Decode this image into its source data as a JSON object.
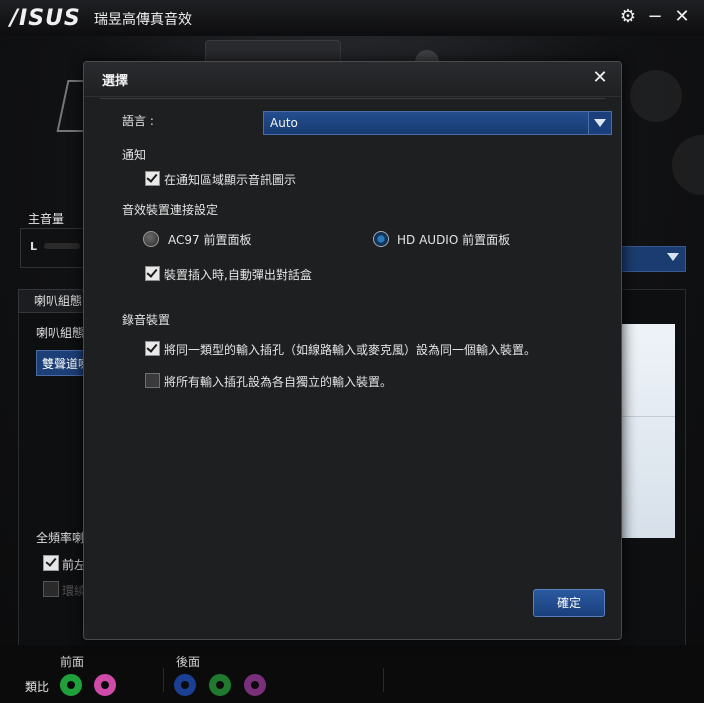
{
  "app": {
    "brand": "/ISUS",
    "title": "瑞昱高傳真音效",
    "gear_icon": "gear-icon",
    "minimize_icon": "minimize-icon",
    "close_icon": "close-icon"
  },
  "background": {
    "master_volume_label": "主音量",
    "volume_channel_left": "L",
    "speaker_tab": "喇叭組態",
    "speaker_config_label": "喇叭組態",
    "stereo_button": "雙聲道喇",
    "fullrange_label": "全頻率喇",
    "front_lr_label": "前左",
    "surround_label": "環繞",
    "front_panel_label": "前面",
    "rear_panel_label": "後面",
    "analog_label": "類比",
    "jack_colors": {
      "front_green": "#1fa03a",
      "front_pink": "#d04aa8",
      "rear_blue": "#1b3f92",
      "rear_green": "#1f7a30",
      "rear_purple": "#7a2f7a"
    }
  },
  "dialog": {
    "title": "選擇",
    "close_icon": "close-icon",
    "language_label": "語言 :",
    "language_value": "Auto",
    "notify_section": "通知",
    "notify_tray_icon": "在通知區域顯示音訊圖示",
    "connection_section": "音效裝置連接設定",
    "ac97_option": "AC97 前置面板",
    "hd_audio_option": "HD AUDIO 前置面板",
    "auto_popup": "裝置插入時,自動彈出對話盒",
    "recording_section": "錄音裝置",
    "same_type_input": "將同一類型的輸入插孔（如線路輸入或麥克風）設為同一個輸入裝置。",
    "separate_inputs": "將所有輸入插孔設為各自獨立的輸入裝置。",
    "ok_button": "確定",
    "accent_color": "#1b3f7a"
  }
}
